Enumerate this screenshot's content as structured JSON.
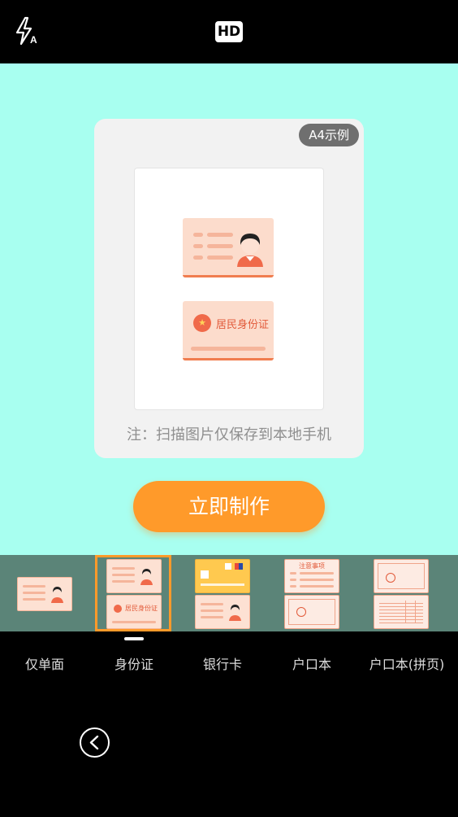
{
  "top_bar": {
    "flash_icon": "flash-auto-icon",
    "hd_label": "HD"
  },
  "preview": {
    "badge": "A4示例",
    "back_card_title": "居民身份证",
    "note": "注：扫描图片仅保存到本地手机"
  },
  "action": {
    "make_label": "立即制作"
  },
  "modes": {
    "selected_index": 1,
    "tabs": [
      {
        "label": "仅单面"
      },
      {
        "label": "身份证"
      },
      {
        "label": "银行卡"
      },
      {
        "label": "户口本"
      },
      {
        "label": "户口本(拼页)"
      }
    ],
    "thumb_texts": {
      "id_back_title": "居民身份证",
      "hukou_title": "注意事项"
    }
  },
  "nav": {
    "back_icon": "chevron-left-icon"
  },
  "colors": {
    "preview_bg": "#a8fff0",
    "accent": "#ff9a2a",
    "strip_bg": "#5b8478"
  }
}
